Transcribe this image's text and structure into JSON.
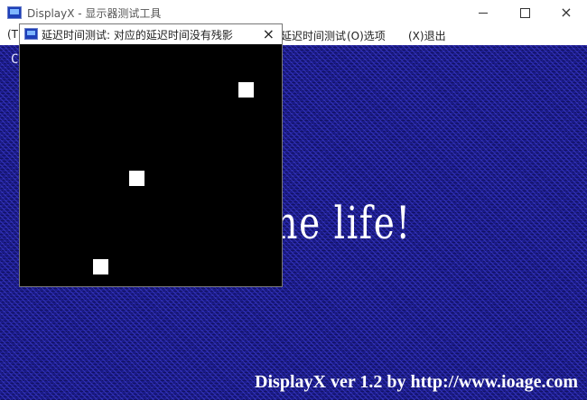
{
  "window": {
    "title": "DisplayX - 显示器测试工具",
    "icon": "app-monitor-icon",
    "minimize": "minimize",
    "maximize": "maximize",
    "close": "×"
  },
  "menu": {
    "items": [
      {
        "label": "(T)"
      },
      {
        "label": "延迟时间测试"
      },
      {
        "label": "(O)选项"
      },
      {
        "label": "(X)退出"
      }
    ]
  },
  "display": {
    "corner_text": "Co",
    "slogan": "he life!",
    "footer": "DisplayX ver 1.2 by http://www.ioage.com",
    "background_color": "#1a1a88"
  },
  "dialog": {
    "title": "延迟时间测试: 对应的延迟时间没有残影",
    "close": "×",
    "icon": "app-monitor-icon",
    "body_color": "#000000",
    "square_color": "#ffffff"
  }
}
